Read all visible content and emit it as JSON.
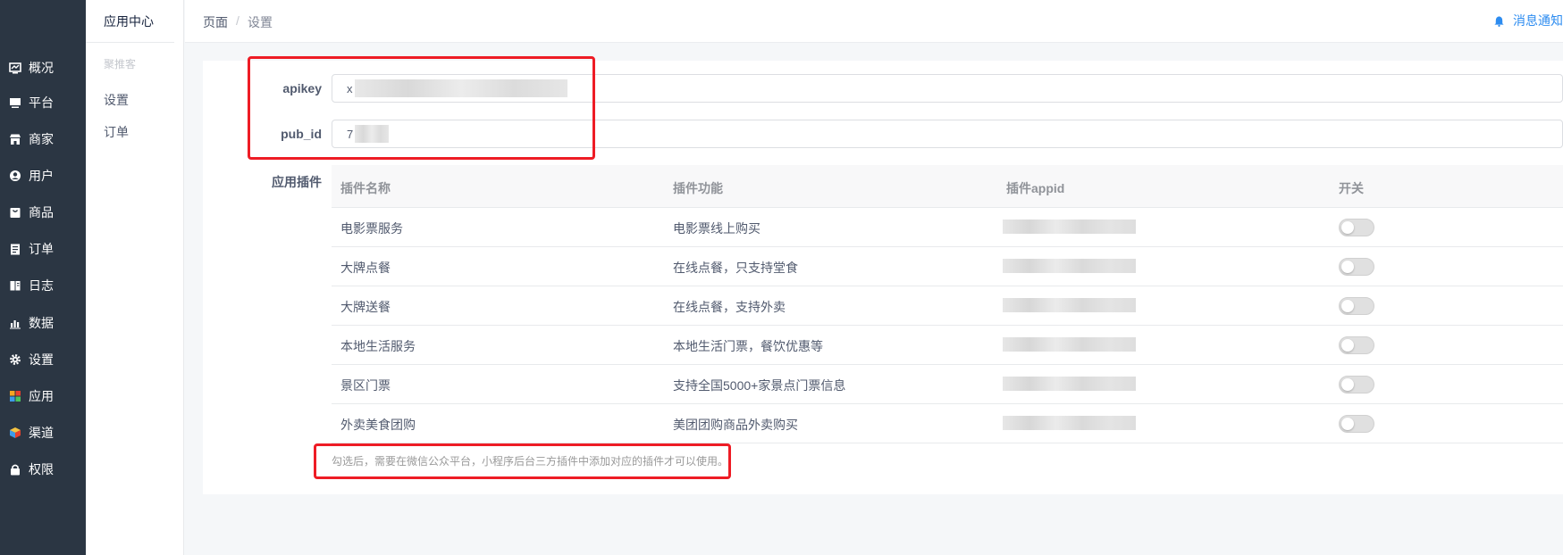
{
  "sidebar": {
    "items": [
      {
        "label": "概况",
        "icon": "dashboard-icon"
      },
      {
        "label": "平台",
        "icon": "monitor-icon"
      },
      {
        "label": "商家",
        "icon": "store-icon"
      },
      {
        "label": "用户",
        "icon": "user-icon"
      },
      {
        "label": "商品",
        "icon": "bag-icon"
      },
      {
        "label": "订单",
        "icon": "clipboard-icon"
      },
      {
        "label": "日志",
        "icon": "book-icon"
      },
      {
        "label": "数据",
        "icon": "bar-chart-icon"
      },
      {
        "label": "设置",
        "icon": "gear-icon"
      },
      {
        "label": "应用",
        "icon": "apps-grid-icon"
      },
      {
        "label": "渠道",
        "icon": "cube-icon"
      },
      {
        "label": "权限",
        "icon": "lock-icon"
      }
    ]
  },
  "submenu": {
    "title": "应用中心",
    "group": "聚推客",
    "items": [
      "设置",
      "订单"
    ]
  },
  "header": {
    "breadcrumb": [
      "页面",
      "设置"
    ],
    "separator": "/",
    "notice": "消息通知"
  },
  "form": {
    "apikey_label": "apikey",
    "apikey_value": "x",
    "pub_id_label": "pub_id",
    "pub_id_value": "7",
    "plugins_label": "应用插件"
  },
  "table": {
    "columns": [
      "插件名称",
      "插件功能",
      "插件appid",
      "开关"
    ],
    "rows": [
      {
        "name": "电影票服务",
        "func": "电影票线上购买",
        "enabled": false
      },
      {
        "name": "大牌点餐",
        "func": "在线点餐，只支持堂食",
        "enabled": false
      },
      {
        "name": "大牌送餐",
        "func": "在线点餐，支持外卖",
        "enabled": false
      },
      {
        "name": "本地生活服务",
        "func": "本地生活门票，餐饮优惠等",
        "enabled": false
      },
      {
        "name": "景区门票",
        "func": "支持全国5000+家景点门票信息",
        "enabled": false
      },
      {
        "name": "外卖美食团购",
        "func": "美团团购商品外卖购买",
        "enabled": false
      }
    ]
  },
  "tip": "勾选后，需要在微信公众平台，小程序后台三方插件中添加对应的插件才可以使用。",
  "colors": {
    "sidebar_bg": "#2b3643",
    "accent": "#2d8cf0",
    "highlight": "#ee1c25"
  }
}
